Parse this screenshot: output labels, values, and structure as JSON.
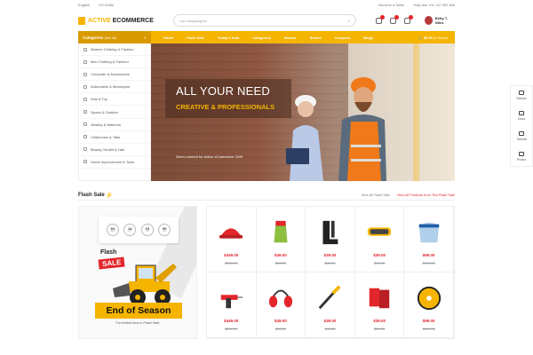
{
  "topbar": {
    "language": "English",
    "currency": "US Dollar",
    "become_seller": "Become a Seller",
    "helpline": "Help line +01 112 352 566"
  },
  "logo": {
    "part1": "ACTIVE",
    "part2": "ECOMMERCE"
  },
  "search": {
    "placeholder": "I am shopping for..."
  },
  "header": {
    "badges": {
      "compare": "0",
      "wishlist": "0",
      "notifications": "1"
    },
    "user_name": "Betty T. Niles"
  },
  "nav": {
    "categories_label": "Categories",
    "see_all": "(See All)",
    "links": [
      "Home",
      "Flash Sale",
      "Today's Deal",
      "Categories",
      "Brands",
      "Sellers",
      "Coupons",
      "Blogs"
    ],
    "cart": "$0.00",
    "cart_items": "(0 Items)"
  },
  "categories": [
    "Women Clothing & Fashion",
    "Men Clothing & Fashion",
    "Computer & Accessories",
    "Automobile & Motorcycle",
    "Kids & Toy",
    "Sports & Outdoor",
    "Jewelry & Watches",
    "Cellphones & Tabs",
    "Beauty, Health & Hair",
    "Home Improvement & Tools"
  ],
  "hero": {
    "title": "ALL YOUR NEED",
    "subtitle": "CREATIVE & PROFESSIONALS",
    "caption": "Demo content for Active eCommerce CMS"
  },
  "side_tools": [
    "Demos",
    "Docs",
    "Tutorial",
    "Promo"
  ],
  "flash_sale": {
    "title": "Flash Sale",
    "view_all": "View All Flash Sale",
    "view_all_products": "View All Products from This Flash Sale",
    "timer": [
      {
        "value": "94",
        "unit": "days"
      },
      {
        "value": "14",
        "unit": "hrs"
      },
      {
        "value": "15",
        "unit": "min"
      },
      {
        "value": "00",
        "unit": "sec"
      }
    ],
    "promo_flash": "Flash",
    "promo_sale": "SALE",
    "promo_end": "End of Season",
    "promo_sub": "For limited time in Flash Sale"
  },
  "products": [
    {
      "icon": "hard-hat-icon",
      "price": "$449.00",
      "old": "$599.00"
    },
    {
      "icon": "work-glove-icon",
      "price": "$49.00",
      "old": "$59.00"
    },
    {
      "icon": "rubber-boot-icon",
      "price": "$39.00",
      "old": "$49.00"
    },
    {
      "icon": "safety-goggles-icon",
      "price": "$39.00",
      "old": "$49.00"
    },
    {
      "icon": "face-shield-icon",
      "price": "$99.00",
      "old": "$119.00"
    },
    {
      "icon": "power-drill-icon",
      "price": "$449.00",
      "old": "$599.00"
    },
    {
      "icon": "ear-muffs-icon",
      "price": "$49.00",
      "old": "$59.00"
    },
    {
      "icon": "screwdriver-set-icon",
      "price": "$39.00",
      "old": "$49.00"
    },
    {
      "icon": "gloves-pack-icon",
      "price": "$39.00",
      "old": "$49.00"
    },
    {
      "icon": "saw-blade-icon",
      "price": "$99.00",
      "old": "$119.00"
    }
  ],
  "colors": {
    "accent": "#f5b400",
    "sale": "#e3262b"
  }
}
